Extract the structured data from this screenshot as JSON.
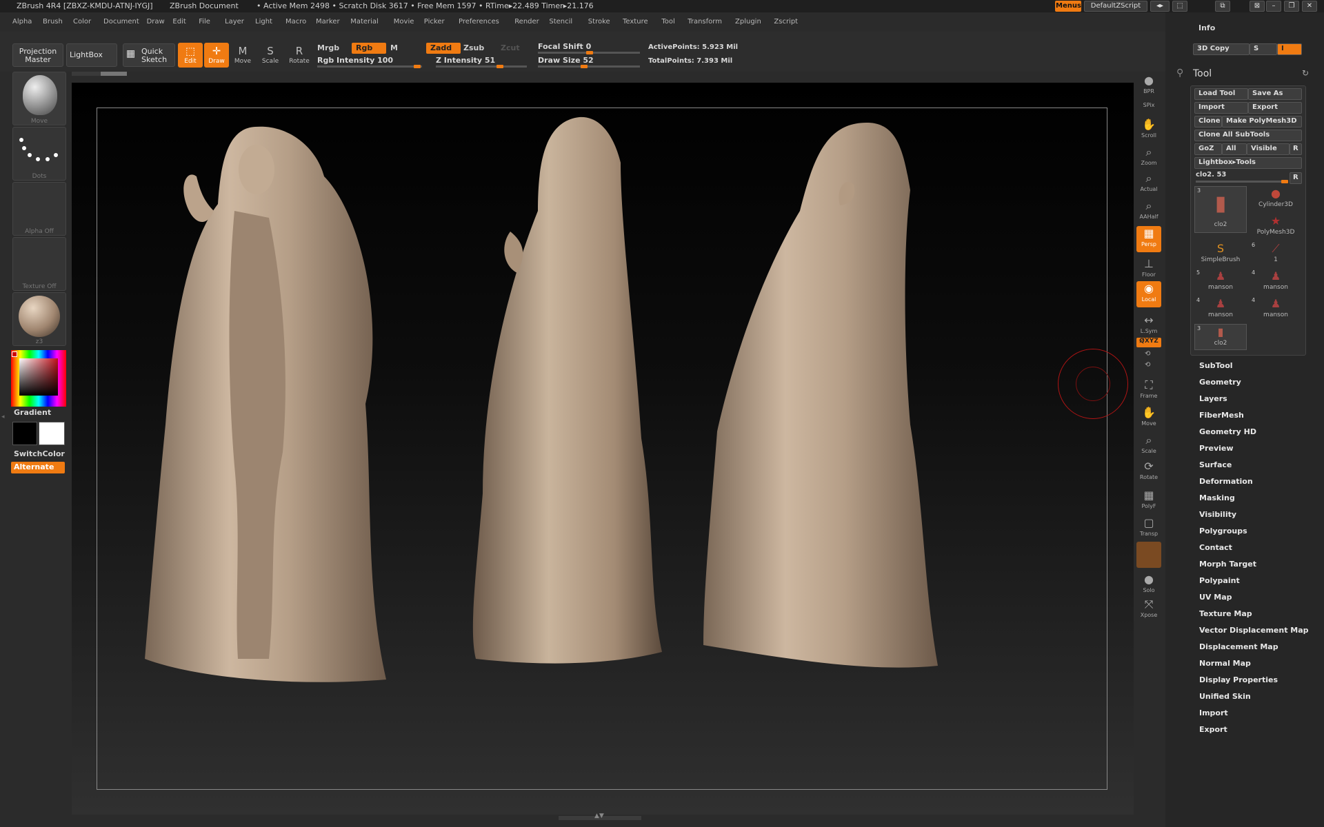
{
  "titlebar": {
    "app": "ZBrush 4R4 [ZBXZ-KMDU-ATNJ-IYGJ]",
    "doc": "ZBrush Document",
    "stats": "• Active Mem 2498 • Scratch Disk 3617 • Free Mem 1597 • RTime▸22.489 Timer▸21.176",
    "menus_btn": "Menus",
    "script_btn": "DefaultZScript"
  },
  "menubar": [
    "Alpha",
    "Brush",
    "Color",
    "Document",
    "Draw",
    "Edit",
    "File",
    "Layer",
    "Light",
    "Macro",
    "Marker",
    "Material",
    "Movie",
    "Picker",
    "Preferences",
    "Render",
    "Stencil",
    "Stroke",
    "Texture",
    "Tool",
    "Transform",
    "Zplugin",
    "Zscript"
  ],
  "shelf": {
    "projection_master": "Projection Master",
    "lightbox": "LightBox",
    "quick_sketch": "Quick Sketch",
    "edit": "Edit",
    "draw": "Draw",
    "move": "Move",
    "scale": "Scale",
    "rotate": "Rotate",
    "mrgb": "Mrgb",
    "rgb": "Rgb",
    "m": "M",
    "rgb_intensity": "Rgb Intensity 100",
    "zadd": "Zadd",
    "zsub": "Zsub",
    "zcut": "Zcut",
    "z_intensity": "Z Intensity 51",
    "focal_shift": "Focal Shift 0",
    "draw_size": "Draw Size 52",
    "active_points": "ActivePoints: 5.923 Mil",
    "total_points": "TotalPoints: 7.393 Mil"
  },
  "lefttray": {
    "brush": "Move",
    "stroke": "Dots",
    "alpha": "Alpha Off",
    "texture": "Texture Off",
    "material": "z3",
    "gradient": "Gradient",
    "switch_color": "SwitchColor",
    "alternate": "Alternate"
  },
  "righttools": [
    {
      "label": "BPR",
      "on": false,
      "g": "●"
    },
    {
      "label": "SPix",
      "on": false,
      "g": ""
    },
    {
      "label": "Scroll",
      "on": false,
      "g": "✋"
    },
    {
      "label": "Zoom",
      "on": false,
      "g": "⌕"
    },
    {
      "label": "Actual",
      "on": false,
      "g": "⌕"
    },
    {
      "label": "AAHalf",
      "on": false,
      "g": "⌕"
    },
    {
      "label": "Persp",
      "on": true,
      "g": "▦"
    },
    {
      "label": "Floor",
      "on": false,
      "g": "⊥"
    },
    {
      "label": "Local",
      "on": true,
      "g": "◉"
    },
    {
      "label": "L.Sym",
      "on": false,
      "g": "↔"
    },
    {
      "label": "Frame",
      "on": false,
      "g": "⛶"
    },
    {
      "label": "Move",
      "on": false,
      "g": "✋"
    },
    {
      "label": "Scale",
      "on": false,
      "g": "⌕"
    },
    {
      "label": "Rotate",
      "on": false,
      "g": "⟳"
    },
    {
      "label": "PolyF",
      "on": false,
      "g": "▦"
    },
    {
      "label": "Transp",
      "on": false,
      "g": "▢"
    },
    {
      "label": "Solo",
      "on": false,
      "g": "●"
    },
    {
      "label": "Xpose",
      "on": false,
      "g": "⤧"
    }
  ],
  "xyz_label": "Q̸XYZ",
  "rightpanel": {
    "info": "Info",
    "copy3d": "3D Copy",
    "s": "S",
    "i": "I",
    "tool_title": "Tool",
    "load_tool": "Load Tool",
    "save_as": "Save As",
    "import": "Import",
    "export": "Export",
    "clone": "Clone",
    "make_polymesh": "Make PolyMesh3D",
    "clone_all": "Clone All SubTools",
    "goz": "GoZ",
    "all": "All",
    "visible": "Visible",
    "r": "R",
    "lightbox_tools": "Lightbox▸Tools",
    "current_tool": "clo2. 53",
    "subtools": [
      {
        "name": "clo2",
        "count": "3"
      },
      {
        "name": "Cylinder3D",
        "count": ""
      },
      {
        "name": "PolyMesh3D",
        "count": ""
      },
      {
        "name": "SimpleBrush",
        "count": ""
      },
      {
        "name": "1",
        "count": "6"
      },
      {
        "name": "manson",
        "count": "5"
      },
      {
        "name": "manson",
        "count": "4"
      },
      {
        "name": "manson",
        "count": "4"
      },
      {
        "name": "manson",
        "count": "4"
      },
      {
        "name": "clo2",
        "count": "3"
      }
    ],
    "menu": [
      "SubTool",
      "Geometry",
      "Layers",
      "FiberMesh",
      "Geometry HD",
      "Preview",
      "Surface",
      "Deformation",
      "Masking",
      "Visibility",
      "Polygroups",
      "Contact",
      "Morph Target",
      "Polypaint",
      "UV Map",
      "Texture Map",
      "Vector Displacement Map",
      "Displacement Map",
      "Normal Map",
      "Display Properties",
      "Unified Skin",
      "Import",
      "Export"
    ]
  },
  "colors": {
    "accent": "#f07b12",
    "sculpt": "#b59e87",
    "bg": "#2b2b2b"
  }
}
